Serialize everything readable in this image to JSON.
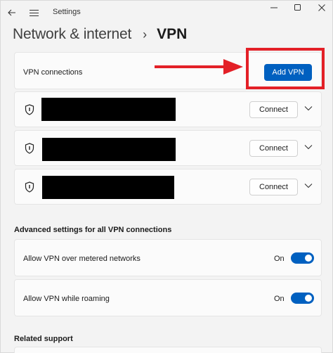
{
  "app": {
    "title": "Settings"
  },
  "breadcrumb": {
    "parent": "Network & internet",
    "separator": "›",
    "current": "VPN"
  },
  "vpn_connections": {
    "label": "VPN connections",
    "add_button_label": "Add VPN"
  },
  "vpn_list": [
    {
      "connect_label": "Connect"
    },
    {
      "connect_label": "Connect"
    },
    {
      "connect_label": "Connect"
    }
  ],
  "advanced": {
    "heading": "Advanced settings for all VPN connections",
    "settings": [
      {
        "label": "Allow VPN over metered networks",
        "state": "On",
        "enabled": true
      },
      {
        "label": "Allow VPN while roaming",
        "state": "On",
        "enabled": true
      }
    ]
  },
  "related": {
    "heading": "Related support"
  },
  "colors": {
    "accent": "#0060c0",
    "annotation": "#e32027",
    "background": "#f3f3f3",
    "card": "#fbfbfb"
  },
  "icons": {
    "back": "back-arrow-icon",
    "menu": "hamburger-menu-icon",
    "minimize": "minimize-icon",
    "maximize": "maximize-icon",
    "close": "close-icon",
    "shield": "shield-icon",
    "chevron": "chevron-down-icon",
    "arrow": "red-arrow-annotation"
  }
}
